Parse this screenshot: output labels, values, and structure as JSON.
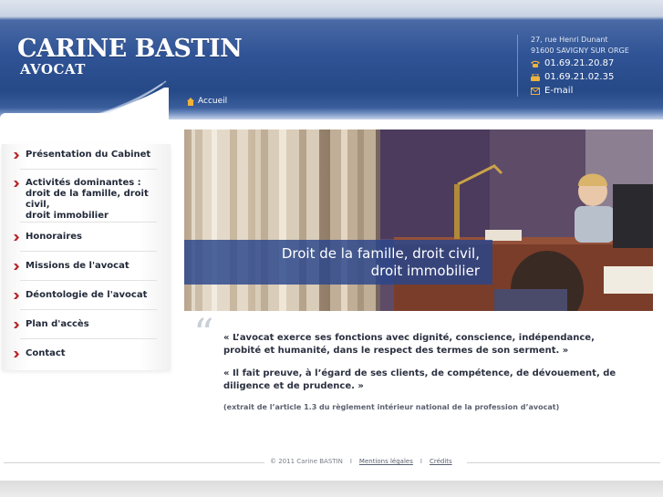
{
  "header": {
    "brand_name": "CARINE BASTIN",
    "brand_subtitle": "AVOCAT",
    "nav_home": "Accueil",
    "address_line1": "27, rue Henri Dunant",
    "address_line2": "91600 SAVIGNY SUR ORGE",
    "phone": "01.69.21.20.87",
    "fax": "01.69.21.02.35",
    "email_label": "E-mail",
    "icons": {
      "home": "home-icon",
      "phone": "phone-icon",
      "fax": "fax-icon",
      "email": "envelope-icon"
    }
  },
  "sidebar": {
    "items": [
      {
        "label": "Présentation du Cabinet"
      },
      {
        "label_lines": [
          "Activités dominantes :",
          "droit de la famille, droit",
          "civil,",
          "droit immobilier"
        ]
      },
      {
        "label": "Honoraires"
      },
      {
        "label": "Missions de l'avocat"
      },
      {
        "label": "Déontologie de l'avocat"
      },
      {
        "label": "Plan d'accès"
      },
      {
        "label": "Contact"
      }
    ]
  },
  "banner": {
    "caption_line1": "Droit de la famille, droit civil,",
    "caption_line2": "droit immobilier"
  },
  "quote": {
    "mark": "“",
    "paragraph1_line1": "« L’avocat exerce ses fonctions avec dignité, conscience, indépendance,",
    "paragraph1_line2": "probité et humanité, dans le respect des termes de son serment. »",
    "paragraph2_line1": "« Il fait preuve, à l’égard de ses clients, de compétence, de dévouement, de",
    "paragraph2_line2": "diligence et de prudence. »",
    "source": "(extrait de l’article 1.3 du règlement intérieur national de la profession d’avocat)"
  },
  "footer": {
    "copyright": "© 2011 Carine BASTIN",
    "separator": "I",
    "legal_link": "Mentions légales",
    "credits_link": "Crédits"
  },
  "colors": {
    "header_blue": "#2f5395",
    "accent_gold": "#f0b23a",
    "menu_text": "#222a3a",
    "caption_band": "#2846a0"
  }
}
